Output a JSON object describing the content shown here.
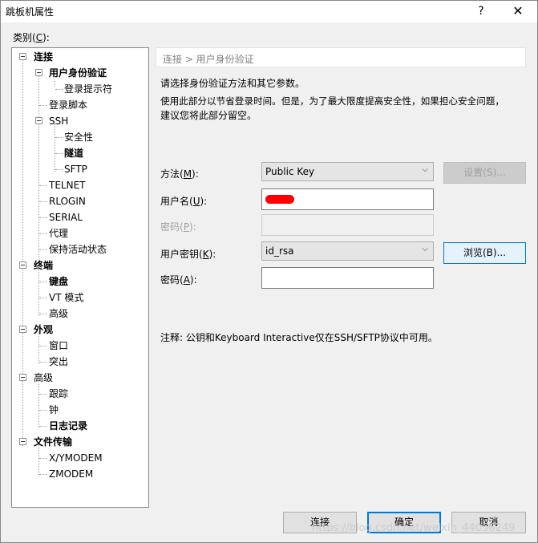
{
  "window": {
    "title": "跳板机属性",
    "help": "?",
    "close": "✕"
  },
  "category_label": {
    "prefix": "类别(",
    "key": "C",
    "suffix": "):"
  },
  "tree": {
    "connection": "连接",
    "user_auth": "用户身份验证",
    "login_prompt": "登录提示符",
    "login_script": "登录脚本",
    "ssh": "SSH",
    "security": "安全性",
    "tunnel": "隧道",
    "sftp": "SFTP",
    "telnet": "TELNET",
    "rlogin": "RLOGIN",
    "serial": "SERIAL",
    "proxy": "代理",
    "keepalive": "保持活动状态",
    "terminal": "终端",
    "keyboard": "键盘",
    "vt_mode": "VT 模式",
    "advanced_term": "高级",
    "appearance": "外观",
    "window": "窗口",
    "highlight": "突出",
    "advanced": "高级",
    "trace": "跟踪",
    "bell": "钟",
    "logging": "日志记录",
    "file_transfer": "文件传输",
    "xymodem": "X/YMODEM",
    "zmodem": "ZMODEM"
  },
  "panel": {
    "breadcrumb": "连接 > 用户身份验证",
    "desc1": "请选择身份验证方法和其它参数。",
    "desc2": "使用此部分以节省登录时间。但是，为了最大限度提高安全性，如果担心安全问题，",
    "desc3": "建议您将此部分留空。",
    "method_label": {
      "prefix": "方法(",
      "key": "M",
      "suffix": "):"
    },
    "method_value": "Public Key",
    "settings_button": "设置(S)...",
    "username_label": {
      "prefix": "用户名(",
      "key": "U",
      "suffix": "):"
    },
    "username_value": "",
    "password_label": {
      "prefix": "密码(",
      "key": "P",
      "suffix": "):"
    },
    "user_key_label": {
      "prefix": "用户密钥(",
      "key": "K",
      "suffix": "):"
    },
    "user_key_value": "id_rsa",
    "browse_button": "浏览(B)...",
    "passphrase_label": {
      "prefix": "密码(",
      "key": "A",
      "suffix": "):"
    },
    "note": "注释: 公钥和Keyboard Interactive仅在SSH/SFTP协议中可用。"
  },
  "buttons": {
    "connect": "连接",
    "ok": "确定",
    "cancel": "取消"
  },
  "watermark": "https://blog.csdn.net/weixin_44056249",
  "colors": {
    "accent": "#0078d7",
    "redaction": "#ff0000"
  }
}
